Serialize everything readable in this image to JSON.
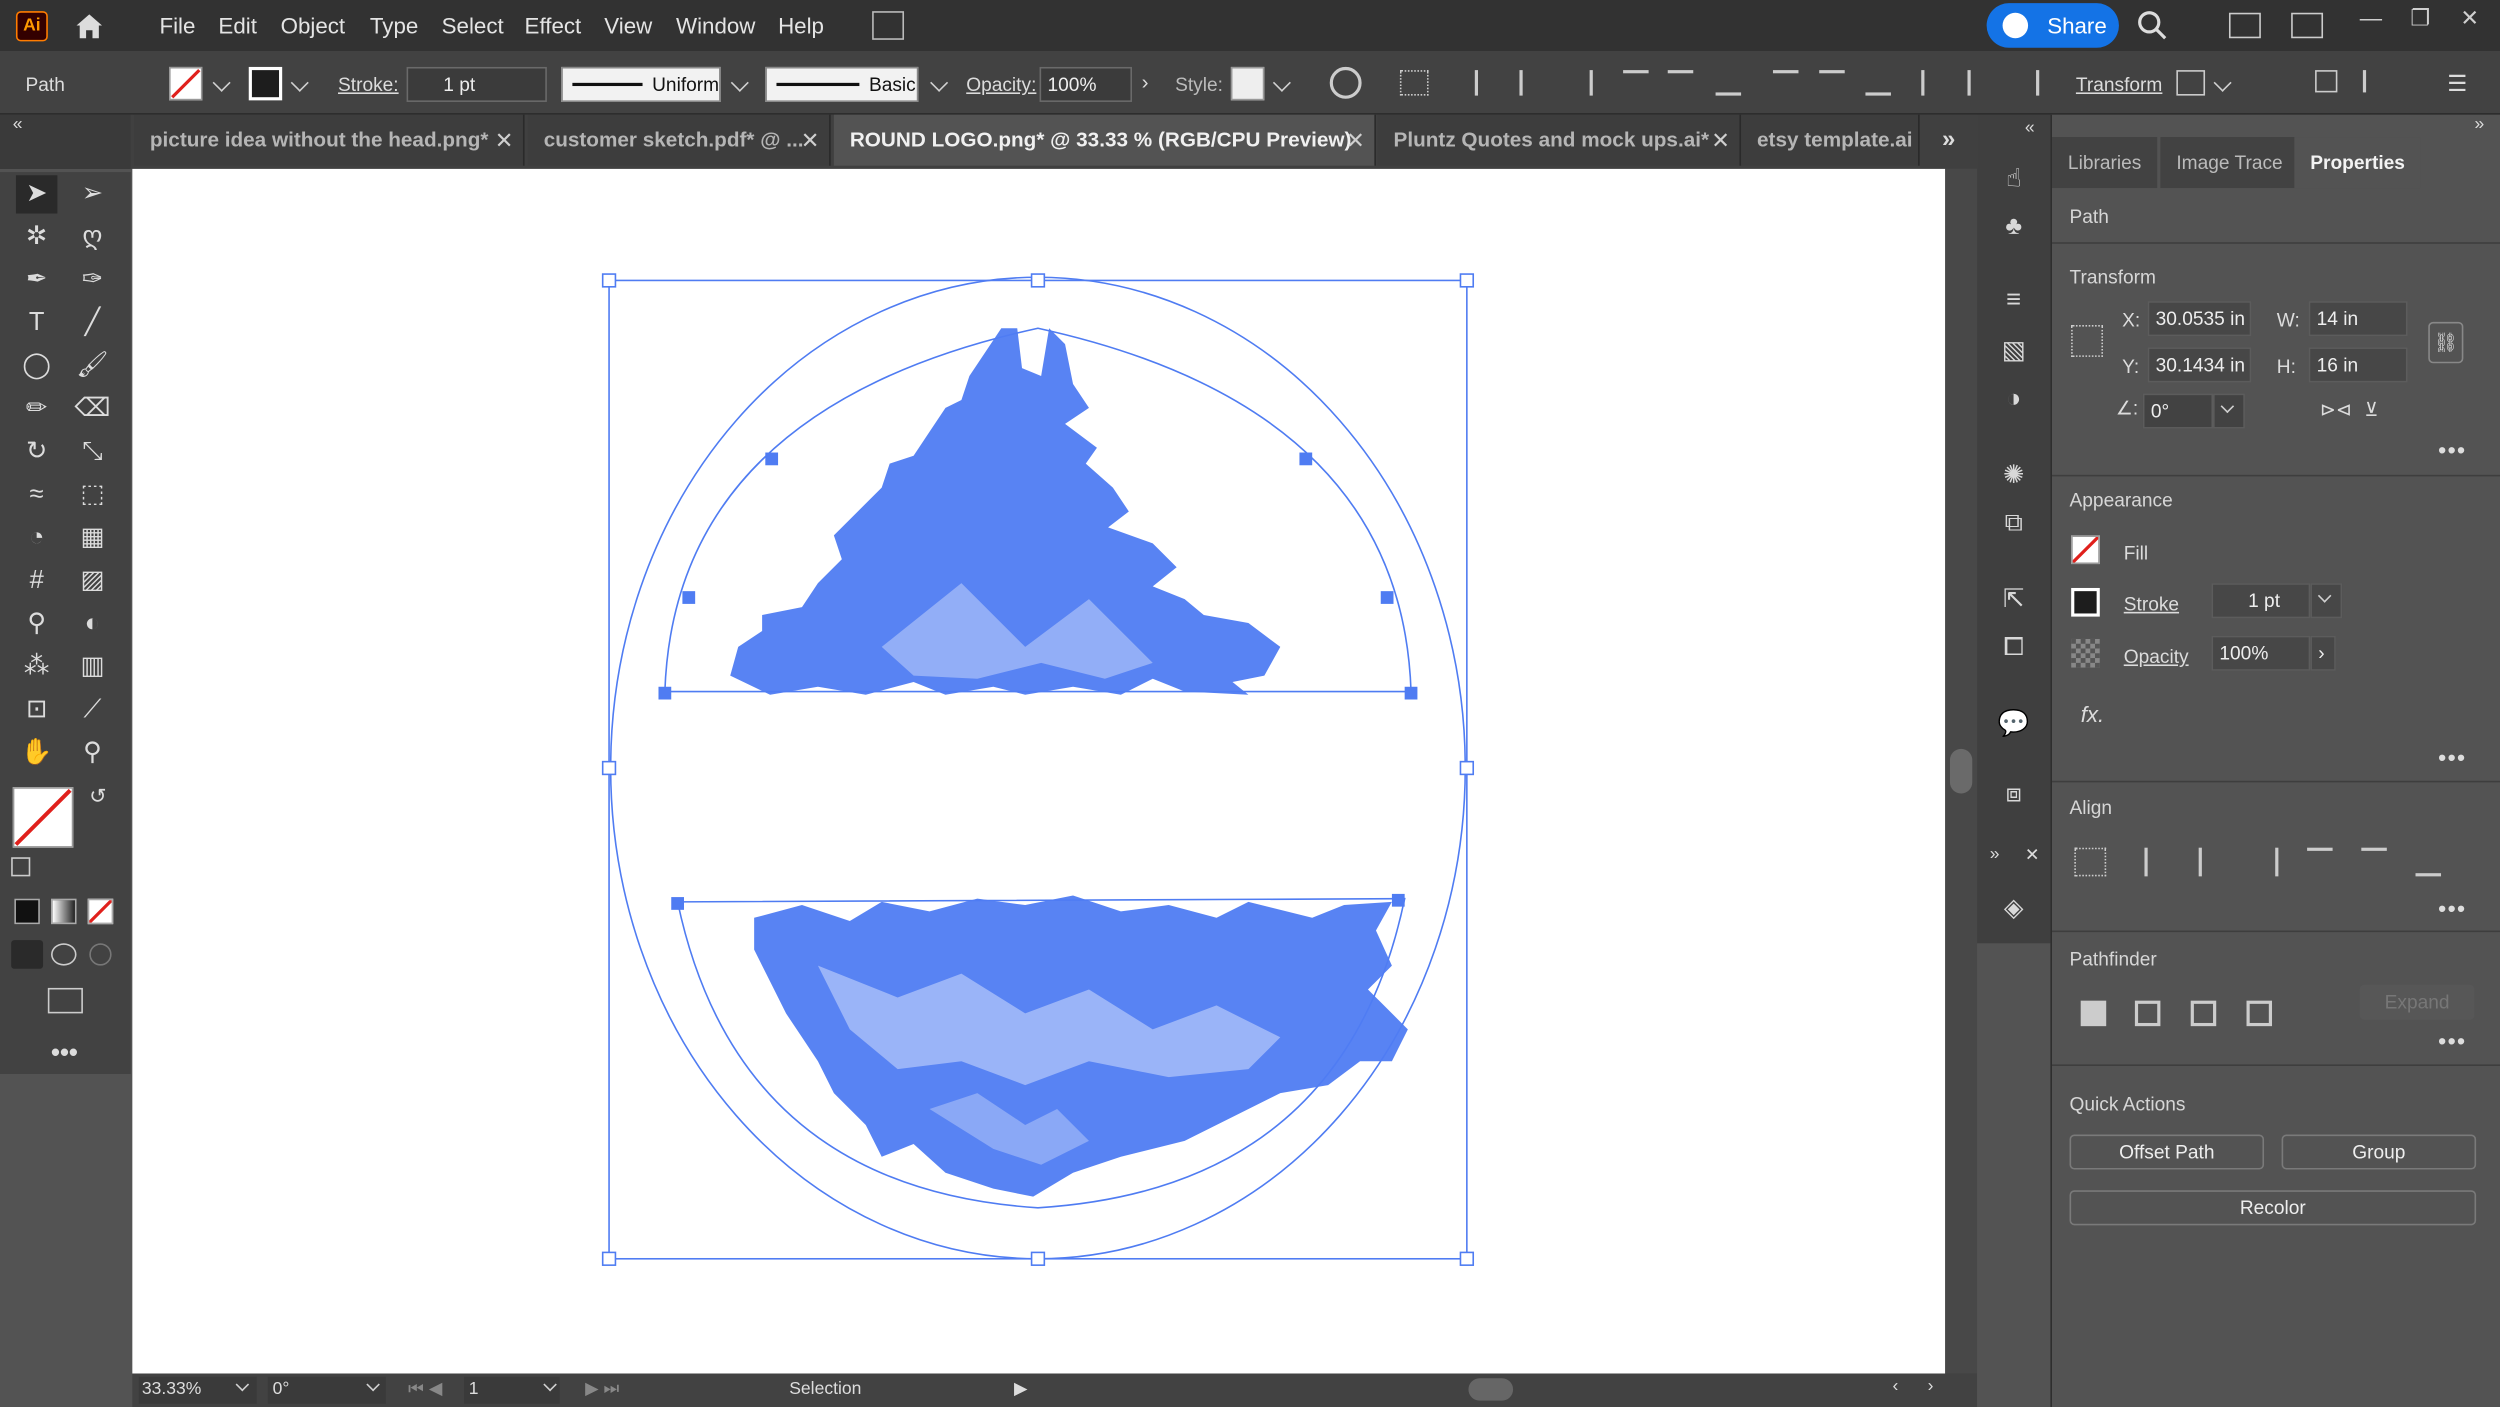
{
  "app": {
    "logo_text": "Ai"
  },
  "menu": [
    "File",
    "Edit",
    "Object",
    "Type",
    "Select",
    "Effect",
    "View",
    "Window",
    "Help"
  ],
  "share_label": "Share",
  "control_bar": {
    "object_type": "Path",
    "stroke_label": "Stroke:",
    "stroke_value": "1 pt",
    "profile_label": "Uniform",
    "brush_label": "Basic",
    "opacity_label": "Opacity:",
    "opacity_value": "100%",
    "style_label": "Style:",
    "transform_label": "Transform"
  },
  "tabs": [
    {
      "label": "picture idea without the head.png*",
      "active": false
    },
    {
      "label": "customer sketch.pdf* @ ...",
      "active": false
    },
    {
      "label": "ROUND LOGO.png* @ 33.33 % (RGB/CPU Preview)",
      "active": true
    },
    {
      "label": "Pluntz Quotes and mock ups.ai*",
      "active": false
    },
    {
      "label": "etsy template.ai",
      "active": false
    }
  ],
  "status": {
    "zoom": "33.33%",
    "rotation": "0°",
    "artboard_number": "1",
    "tool_name": "Selection"
  },
  "panel": {
    "tabs": [
      "Libraries",
      "Image Trace",
      "Properties"
    ],
    "active_tab": "Properties",
    "object_type": "Path",
    "transform": {
      "title": "Transform",
      "x_label": "X:",
      "x_value": "30.0535 in",
      "y_label": "Y:",
      "y_value": "30.1434 in",
      "w_label": "W:",
      "w_value": "14 in",
      "h_label": "H:",
      "h_value": "16 in",
      "angle_value": "0°"
    },
    "appearance": {
      "title": "Appearance",
      "fill_label": "Fill",
      "stroke_label": "Stroke",
      "stroke_value": "1 pt",
      "opacity_label": "Opacity",
      "opacity_value": "100%",
      "fx_label": "fx."
    },
    "align": {
      "title": "Align"
    },
    "pathfinder": {
      "title": "Pathfinder",
      "expand_label": "Expand"
    },
    "quick_actions": {
      "title": "Quick Actions",
      "offset_path": "Offset Path",
      "group": "Group",
      "recolor": "Recolor"
    }
  },
  "colors": {
    "selection": "#4f7cf2",
    "share_button": "#1473e6",
    "logo_orange": "#ff9a00"
  }
}
